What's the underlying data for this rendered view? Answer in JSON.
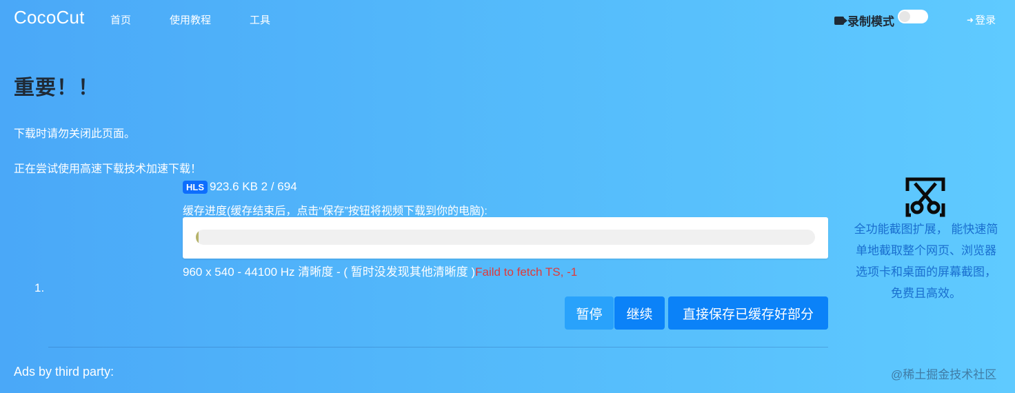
{
  "nav": {
    "brand": "CocoCut",
    "links": [
      "首页",
      "使用教程",
      "工具"
    ],
    "record_label": "录制模式",
    "record_toggle_on": false,
    "login_label": "登录"
  },
  "notice": {
    "title": "重要！！",
    "line1": "下载时请勿关闭此页面。",
    "line2": "正在尝试使用高速下载技术加速下载！"
  },
  "download": {
    "item_number": "1.",
    "badge": "HLS",
    "size_info": "923.6 KB 2 / 694",
    "cache_label": "缓存进度(缓存结束后，点击“保存”按钮将视频下载到你的电脑):",
    "progress_fraction": 0.003,
    "resolution_text": "960 x 540 - 44100 Hz 清晰度 - ( 暂时没发现其他清晰度 )",
    "error_text": "Faild to fetch TS, -1",
    "buttons": {
      "pause": "暂停",
      "resume": "继续",
      "save_partial": "直接保存已缓存好部分"
    }
  },
  "ads_label": "Ads by third party:",
  "sidebar_ad": {
    "icon": "scissors-screenshot-icon",
    "text": "全功能截图扩展， 能快速简单地截取整个网页、浏览器选项卡和桌面的屏幕截图，免费且高效。"
  },
  "watermark": "@稀土掘金技术社区",
  "colors": {
    "error": "#e03a3a",
    "primary_button": "#0b82f8",
    "badge": "#0d6efd",
    "ad_text": "#1a6fcf"
  }
}
